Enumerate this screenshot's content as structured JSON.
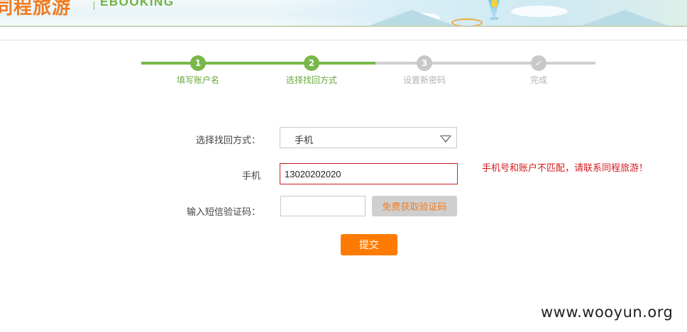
{
  "header": {
    "brand_cn": "同程旅游",
    "brand_en": "EBOOKING"
  },
  "progress": {
    "steps": [
      {
        "number": "1",
        "label": "填写账户名",
        "state": "done"
      },
      {
        "number": "2",
        "label": "选择找回方式",
        "state": "done"
      },
      {
        "number": "3",
        "label": "设置新密码",
        "state": "todo"
      },
      {
        "number": "✓",
        "label": "完成",
        "state": "todo"
      }
    ],
    "active_color": "#78b84a",
    "inactive_color": "#c8c8c8"
  },
  "form": {
    "method_label": "选择找回方式：",
    "method_selected": "手机",
    "phone_label": "手机",
    "phone_value": "13020202020",
    "error_message": "手机号和账户不匹配，请联系同程旅游！",
    "code_label": "输入短信验证码：",
    "code_value": "",
    "get_code_button": "免费获取验证码",
    "submit_button": "提交"
  },
  "colors": {
    "accent_orange": "#ff7a00",
    "error_red": "#d7191c"
  },
  "watermark": "www.wooyun.org"
}
